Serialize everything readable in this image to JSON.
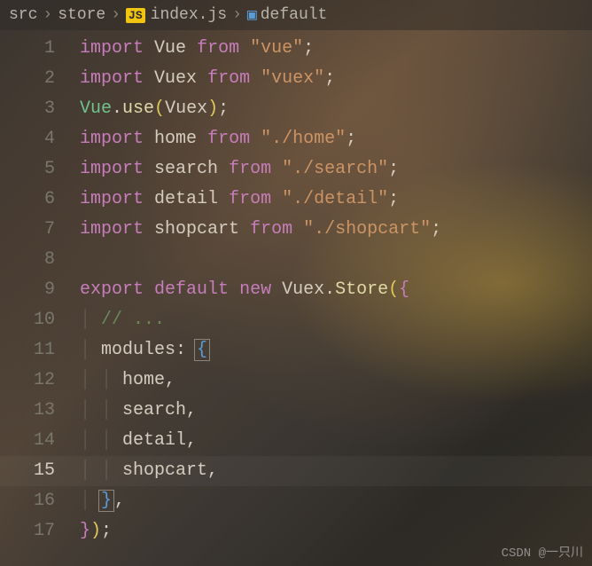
{
  "breadcrumb": {
    "part1": "src",
    "part2": "store",
    "jsBadge": "JS",
    "file": "index.js",
    "symbol": "default"
  },
  "gutter": {
    "l1": "1",
    "l2": "2",
    "l3": "3",
    "l4": "4",
    "l5": "5",
    "l6": "6",
    "l7": "7",
    "l8": "8",
    "l9": "9",
    "l10": "10",
    "l11": "11",
    "l12": "12",
    "l13": "13",
    "l14": "14",
    "l15": "15",
    "l16": "16",
    "l17": "17"
  },
  "tok": {
    "import": "import",
    "from": "from",
    "export": "export",
    "default": "default",
    "new": "new",
    "Vue": "Vue",
    "Vuex": "Vuex",
    "home": "home",
    "search": "search",
    "detail": "detail",
    "shopcart": "shopcart",
    "use": "use",
    "Store": "Store",
    "modules": "modules",
    "str_vue": "\"vue\"",
    "str_vuex": "\"vuex\"",
    "str_home": "\"./home\"",
    "str_search": "\"./search\"",
    "str_detail": "\"./detail\"",
    "str_shopcart": "\"./shopcart\"",
    "comment_dots": "// ...",
    "semi": ";",
    "comma": ",",
    "dot": ".",
    "colon": ": ",
    "lparen": "(",
    "rparen": ")",
    "lbrace": "{",
    "rbrace": "}",
    "space": " "
  },
  "watermark": "CSDN @一只川"
}
